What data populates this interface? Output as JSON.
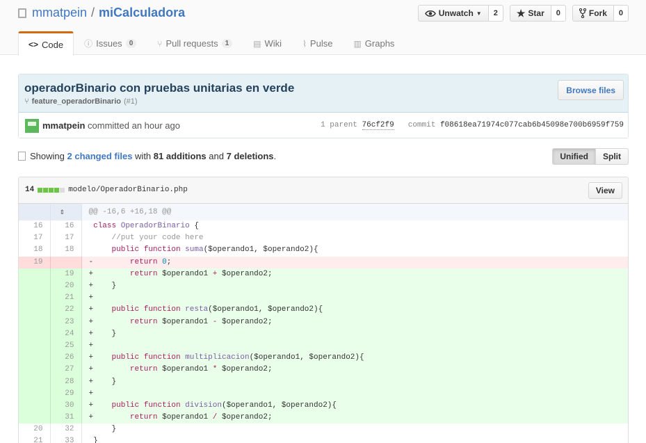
{
  "repo": {
    "owner": "mmatpein",
    "separator": "/",
    "name": "miCalculadora"
  },
  "actions": [
    {
      "label": "Unwatch",
      "count": "2",
      "icon": "eye-icon"
    },
    {
      "label": "Star",
      "count": "0",
      "icon": "star-icon"
    },
    {
      "label": "Fork",
      "count": "0",
      "icon": "fork-icon"
    }
  ],
  "tabs": [
    {
      "label": "Code",
      "icon": "code-icon",
      "counter": ""
    },
    {
      "label": "Issues",
      "icon": "issue-icon",
      "counter": "0"
    },
    {
      "label": "Pull requests",
      "icon": "pull-request-icon",
      "counter": "1"
    },
    {
      "label": "Wiki",
      "icon": "book-icon",
      "counter": ""
    },
    {
      "label": "Pulse",
      "icon": "pulse-icon",
      "counter": ""
    },
    {
      "label": "Graphs",
      "icon": "graph-icon",
      "counter": ""
    }
  ],
  "commit": {
    "title": "operadorBinario con pruebas unitarias en verde",
    "branch": "feature_operadorBinario",
    "pr": "(#1)",
    "browse_label": "Browse files",
    "author": "mmatpein",
    "action": "committed an hour ago",
    "parent_label": "1 parent",
    "parent_sha": "76cf2f9",
    "commit_label": "commit",
    "commit_sha": "f08618ea71974c077cab6b45098e700b6959f759"
  },
  "toc": {
    "showing": "Showing",
    "changed_files": "2 changed files",
    "with": "with",
    "additions": "81 additions",
    "and": "and",
    "deletions": "7 deletions",
    "period": ".",
    "unified_label": "Unified",
    "split_label": "Split"
  },
  "file": {
    "changes": "14",
    "path": "modelo/OperadorBinario.php",
    "view_label": "View",
    "hunk": "@@ -16,6 +16,18 @@"
  },
  "colors": {
    "addition": "#6cc644",
    "link": "#4078c0",
    "tab_accent": "#d26911"
  }
}
